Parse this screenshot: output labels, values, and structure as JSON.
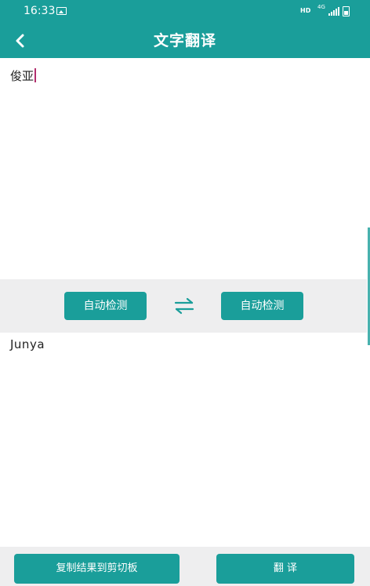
{
  "status_bar": {
    "time": "16:33",
    "hd": "HD",
    "network": "4G"
  },
  "header": {
    "title": "文字翻译"
  },
  "input": {
    "text": "俊亚"
  },
  "languages": {
    "source": "自动检测",
    "target": "自动检测"
  },
  "output": {
    "text": "Junya"
  },
  "actions": {
    "copy_label": "复制结果到剪切板",
    "translate_label": "翻 译"
  },
  "colors": {
    "accent": "#1a9e9a",
    "caret": "#b2306e",
    "panel_bg": "#eeeeef"
  },
  "icons": {
    "back": "back-arrow-icon",
    "swap": "swap-arrows-icon",
    "gallery": "image-icon",
    "signal": "signal-icon",
    "battery": "battery-icon"
  }
}
